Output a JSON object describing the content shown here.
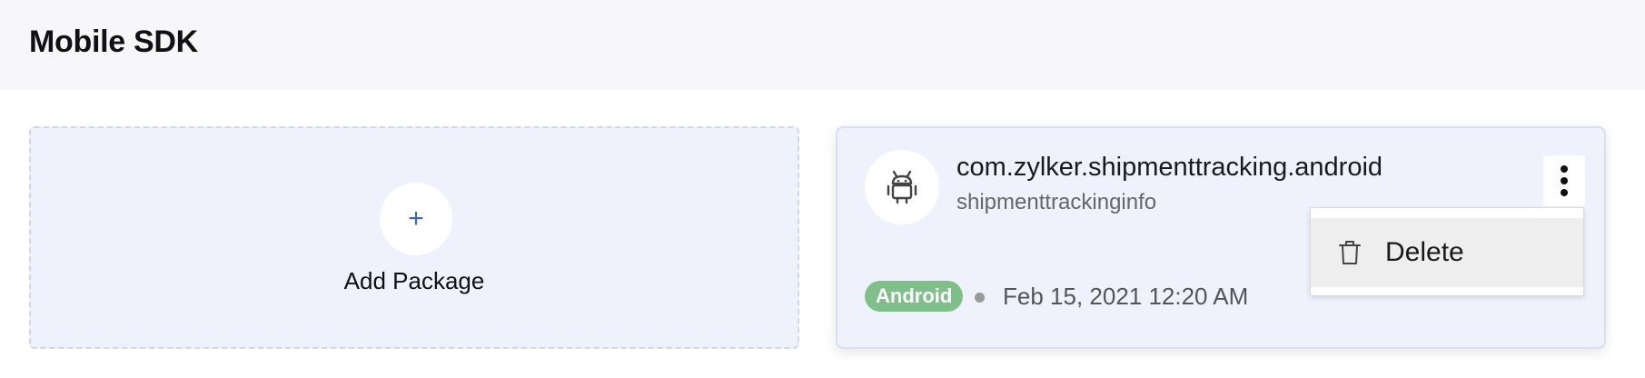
{
  "header": {
    "title": "Mobile SDK"
  },
  "add_package": {
    "label": "Add Package",
    "icon": "plus-icon",
    "plus_symbol": "+"
  },
  "package": {
    "name": "com.zylker.shipmenttracking.android",
    "subtitle": "shipmenttrackinginfo",
    "platform_icon": "android-icon",
    "platform_badge": "Android",
    "created_at": "Feb 15, 2021 12:20 AM"
  },
  "menu": {
    "items": [
      {
        "label": "Delete",
        "icon": "trash-icon"
      }
    ]
  },
  "colors": {
    "accent": "#3b64c5",
    "badge_green": "#7fbf8a",
    "card_bg": "#eff2fd"
  }
}
